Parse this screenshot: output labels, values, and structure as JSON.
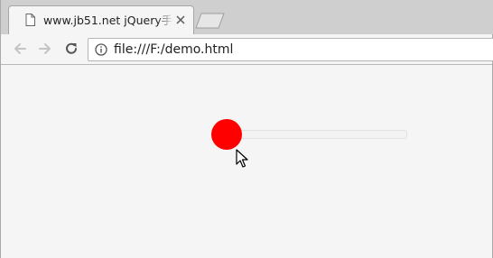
{
  "tab": {
    "title": "www.jb51.net jQuery手",
    "doc_icon": "page-icon",
    "close_icon": "close-icon"
  },
  "toolbar": {
    "back_icon": "back-arrow-icon",
    "forward_icon": "forward-arrow-icon",
    "reload_icon": "reload-icon",
    "info_icon": "info-icon",
    "url": "file:///F:/demo.html"
  },
  "slider": {
    "value_fraction": 0.0,
    "thumb_color": "#ff0000",
    "track_color": "#f3f3f3"
  },
  "colors": {
    "tabstrip": "#cfcfcf",
    "toolbar": "#f5f5f5",
    "page": "#f5f5f5"
  }
}
